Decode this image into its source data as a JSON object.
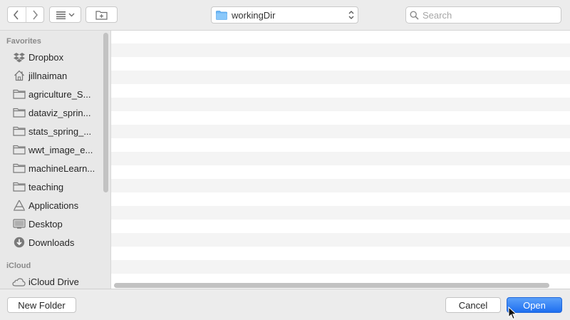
{
  "toolbar": {
    "back_icon": "chevron-left-icon",
    "forward_icon": "chevron-right-icon",
    "view_icon": "list-view-icon",
    "new_folder_icon": "new-folder-icon",
    "location": "workingDir",
    "search_placeholder": "Search"
  },
  "sidebar": {
    "favorites_label": "Favorites",
    "icloud_label": "iCloud",
    "favorites": [
      {
        "label": "Dropbox",
        "icon": "dropbox-icon"
      },
      {
        "label": "jillnaiman",
        "icon": "home-icon"
      },
      {
        "label": "agriculture_S...",
        "icon": "folder-icon"
      },
      {
        "label": "dataviz_sprin...",
        "icon": "folder-icon"
      },
      {
        "label": "stats_spring_...",
        "icon": "folder-icon"
      },
      {
        "label": "wwt_image_e...",
        "icon": "folder-icon"
      },
      {
        "label": "machineLearn...",
        "icon": "folder-icon"
      },
      {
        "label": "teaching",
        "icon": "folder-icon"
      },
      {
        "label": "Applications",
        "icon": "applications-icon"
      },
      {
        "label": "Desktop",
        "icon": "desktop-icon"
      },
      {
        "label": "Downloads",
        "icon": "downloads-icon"
      }
    ],
    "icloud": [
      {
        "label": "iCloud Drive",
        "icon": "cloud-icon"
      }
    ]
  },
  "footer": {
    "new_folder_label": "New Folder",
    "cancel_label": "Cancel",
    "open_label": "Open"
  },
  "colors": {
    "accent": "#2e7cf6",
    "stripe": "#f4f4f4",
    "sidebar": "#e8e8e8"
  }
}
